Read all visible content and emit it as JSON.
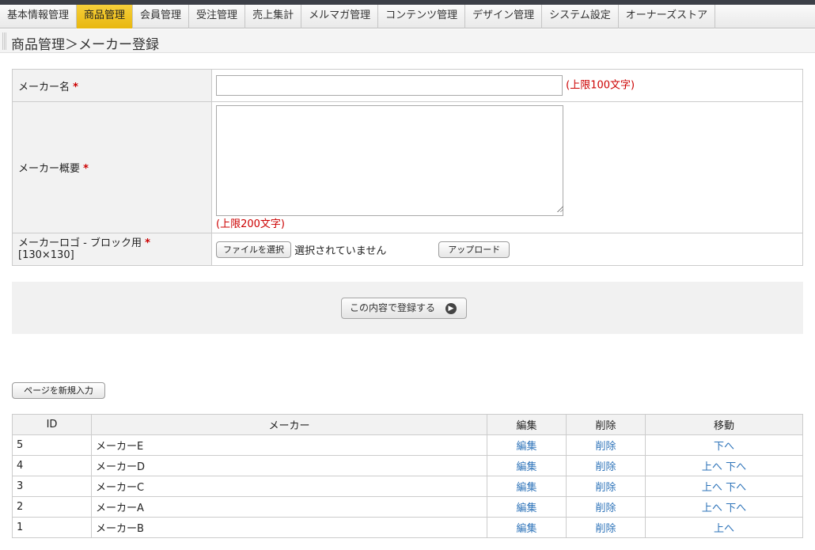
{
  "nav": {
    "items": [
      {
        "label": "基本情報管理",
        "active": false
      },
      {
        "label": "商品管理",
        "active": true
      },
      {
        "label": "会員管理",
        "active": false
      },
      {
        "label": "受注管理",
        "active": false
      },
      {
        "label": "売上集計",
        "active": false
      },
      {
        "label": "メルマガ管理",
        "active": false
      },
      {
        "label": "コンテンツ管理",
        "active": false
      },
      {
        "label": "デザイン管理",
        "active": false
      },
      {
        "label": "システム設定",
        "active": false
      },
      {
        "label": "オーナーズストア",
        "active": false
      }
    ],
    "active_color": "#f0c419"
  },
  "page": {
    "title": "商品管理＞メーカー登録"
  },
  "form": {
    "required_mark": "*",
    "maker_name": {
      "label": "メーカー名",
      "value": "",
      "limit": "(上限100文字)"
    },
    "maker_summary": {
      "label": "メーカー概要",
      "value": "",
      "limit": "(上限200文字)"
    },
    "maker_logo": {
      "label": "メーカーロゴ - ブロック用",
      "size": "[130×130]",
      "file_button": "ファイルを選択",
      "file_status": "選択されていません",
      "upload_button": "アップロード"
    }
  },
  "submit": {
    "label": "この内容で登録する",
    "icon": "arrow-right-icon"
  },
  "new_page_button": "ページを新規入力",
  "list": {
    "headers": {
      "id": "ID",
      "maker": "メーカー",
      "edit": "編集",
      "delete": "削除",
      "move": "移動"
    },
    "rows": [
      {
        "id": "5",
        "maker": "メーカーE",
        "edit": "編集",
        "delete": "削除",
        "up": "",
        "down": "下へ"
      },
      {
        "id": "4",
        "maker": "メーカーD",
        "edit": "編集",
        "delete": "削除",
        "up": "上へ",
        "down": "下へ"
      },
      {
        "id": "3",
        "maker": "メーカーC",
        "edit": "編集",
        "delete": "削除",
        "up": "上へ",
        "down": "下へ"
      },
      {
        "id": "2",
        "maker": "メーカーA",
        "edit": "編集",
        "delete": "削除",
        "up": "上へ",
        "down": "下へ"
      },
      {
        "id": "1",
        "maker": "メーカーB",
        "edit": "編集",
        "delete": "削除",
        "up": "上へ",
        "down": ""
      }
    ],
    "link_color": "#2d73b9"
  }
}
